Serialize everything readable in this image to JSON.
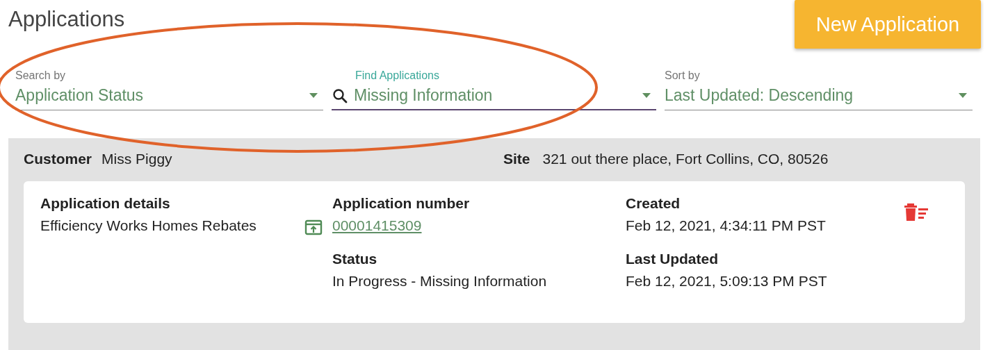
{
  "page": {
    "title": "Applications"
  },
  "new_button": {
    "label": "New Application"
  },
  "filters": [
    {
      "kind": "select",
      "label": "Search by",
      "value": "Application Status",
      "focused": false
    },
    {
      "kind": "search",
      "label": "Find Applications",
      "value": "Missing Information",
      "focused": true
    },
    {
      "kind": "select",
      "label": "Sort by",
      "value": "Last Updated: Descending",
      "focused": false
    }
  ],
  "annotation": {
    "kind": "ellipse"
  },
  "results": [
    {
      "customer_label": "Customer",
      "customer": "Miss Piggy",
      "site_label": "Site",
      "site": "321 out there place, Fort Collins, CO, 80526",
      "details_label": "Application details",
      "details": "Efficiency Works Homes Rebates",
      "number_label": "Application number",
      "number": "00001415309",
      "status_label": "Status",
      "status": "In Progress - Missing Information",
      "created_label": "Created",
      "created": "Feb 12, 2021, 4:34:11 PM PST",
      "updated_label": "Last Updated",
      "updated": "Feb 12, 2021, 5:09:13 PM PST"
    }
  ]
}
